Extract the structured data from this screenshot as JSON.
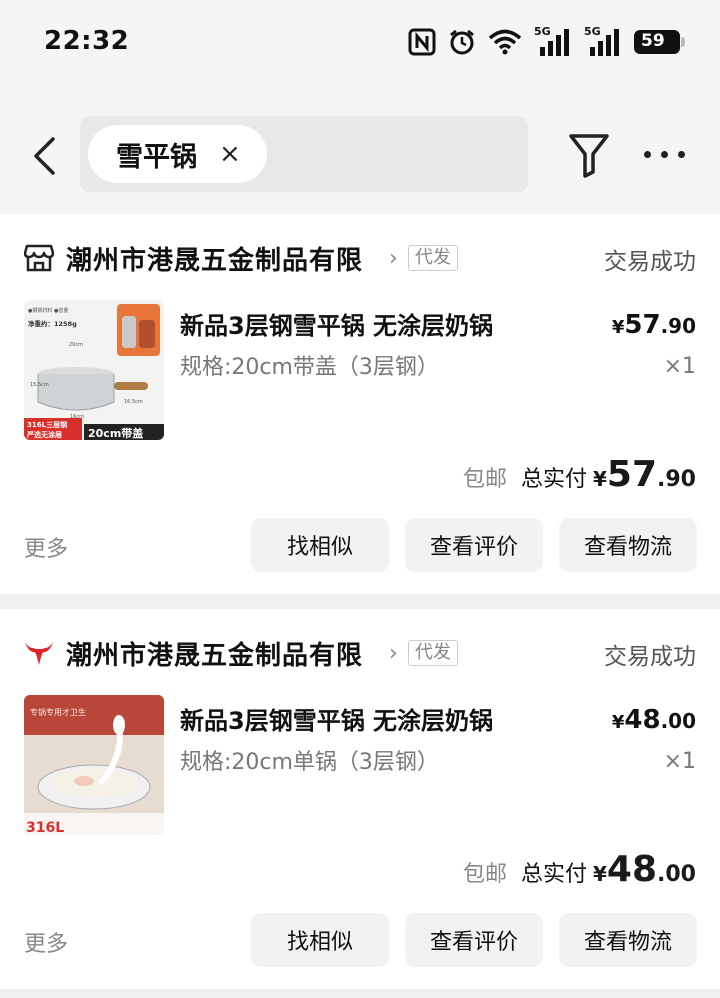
{
  "status_bar": {
    "time": "22:32",
    "battery": "59",
    "network_tags": [
      "5G",
      "5G"
    ]
  },
  "header": {
    "search_chip": "雪平锅",
    "chip_close": "×"
  },
  "orders": [
    {
      "store_name": "潮州市港晟五金制品有限",
      "store_icon": "store-icon",
      "tag": "代发",
      "status": "交易成功",
      "product": {
        "title": "新品3层钢雪平锅 无涂层奶锅",
        "spec": "规格:20cm带盖（3层钢）",
        "price_currency": "¥",
        "price_int": "57",
        "price_dec": ".90",
        "qty": "×1",
        "thumb_texts": [
          "净重约：1258g",
          "20cm",
          "15.5cm",
          "16cm",
          "16.5cm",
          "316L三层钢",
          "严选无涂层",
          "20cm带盖"
        ]
      },
      "free_shipping": "包邮",
      "total_label": "总实付",
      "total_currency": "¥",
      "total_int": "57",
      "total_dec": ".90",
      "more": "更多",
      "buttons": [
        "找相似",
        "查看评价",
        "查看物流"
      ]
    },
    {
      "store_name": "潮州市港晟五金制品有限",
      "store_icon": "bull-logo-icon",
      "tag": "代发",
      "status": "交易成功",
      "product": {
        "title": "新品3层钢雪平锅 无涂层奶锅",
        "spec": "规格:20cm单锅（3层钢）",
        "price_currency": "¥",
        "price_int": "48",
        "price_dec": ".00",
        "qty": "×1",
        "thumb_texts": [
          "专锅专用才卫生",
          "316L"
        ]
      },
      "free_shipping": "包邮",
      "total_label": "总实付",
      "total_currency": "¥",
      "total_int": "48",
      "total_dec": ".00",
      "more": "更多",
      "buttons": [
        "找相似",
        "查看评价",
        "查看物流"
      ]
    }
  ],
  "colors": {
    "accent_red": "#e0242a",
    "page_bg": "#efefef",
    "card_bg": "#ffffff",
    "button_bg": "#f2f2f2"
  }
}
